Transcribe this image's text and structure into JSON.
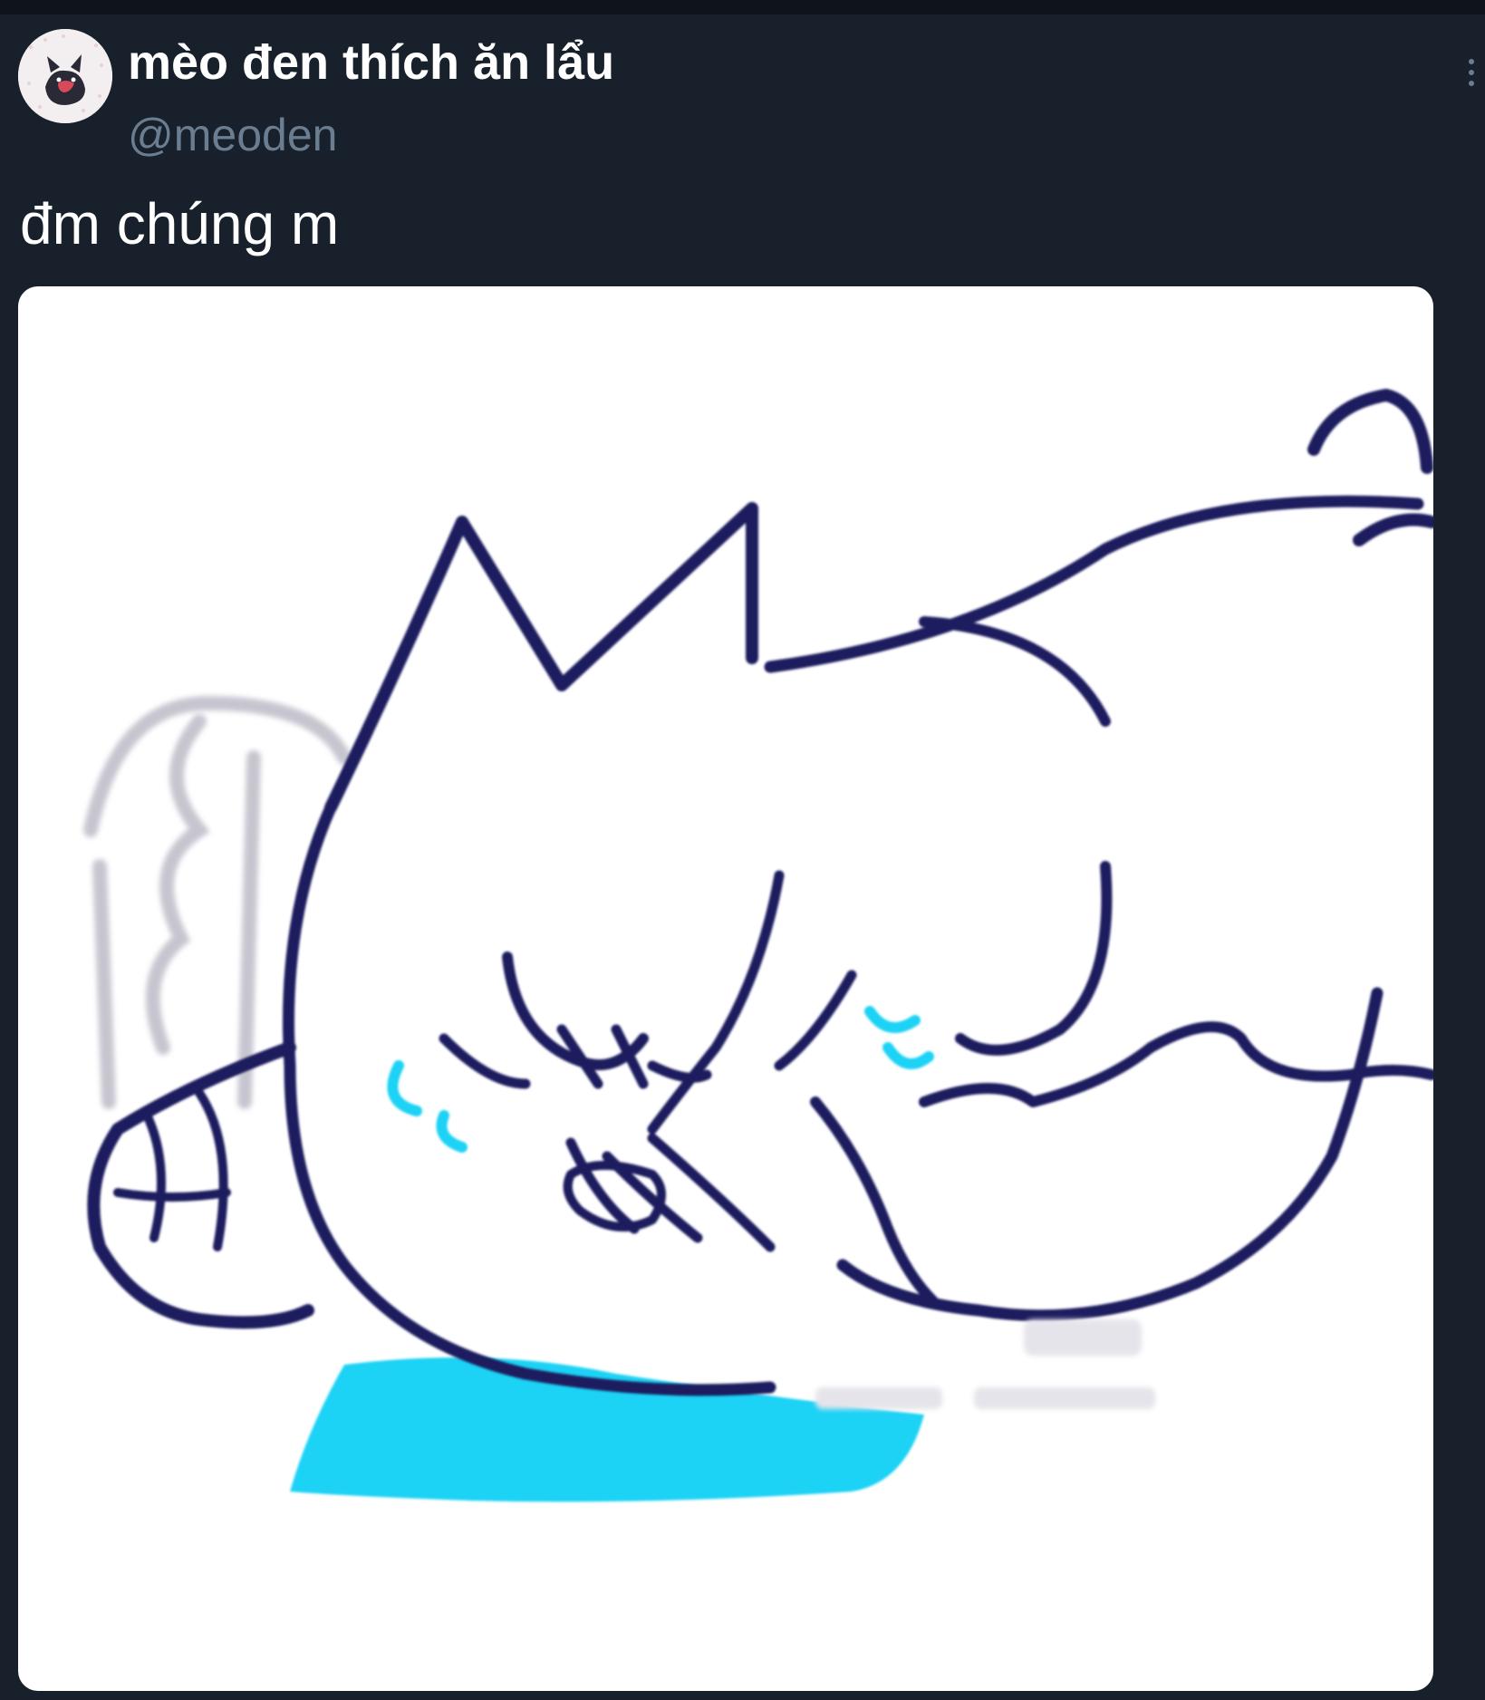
{
  "post": {
    "author": {
      "display_name": "mèo đen thích ăn lẩu",
      "handle": "@meoden",
      "avatar_icon": "cat-avatar-icon"
    },
    "text": "đm chúng m",
    "media": {
      "type": "image",
      "icon": "crying-cat-drawing"
    },
    "menu_icon": "more-vertical-icon"
  },
  "colors": {
    "background": "#17202b",
    "topbar": "#0f141c",
    "text_primary": "#ffffff",
    "text_secondary": "#6b7d90",
    "sketch_line": "#1c1a5e",
    "tear": "#1fd2f5"
  }
}
